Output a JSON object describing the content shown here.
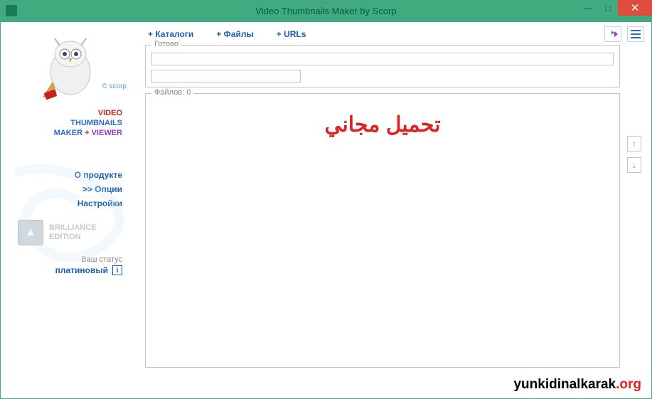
{
  "window": {
    "title": "Video Thumbnails Maker by Scorp"
  },
  "sidebar": {
    "copyright": "© scorp",
    "title_line1": "VIDEO",
    "title_line2": "THUMBNAILS",
    "title_line3a": "MAKER",
    "title_plus": " + ",
    "title_line3b": "VIEWER",
    "menu": {
      "about": "О продукте",
      "options": ">> Опции",
      "settings": "Настройки"
    },
    "edition_line1": "BRILLIANCE",
    "edition_line2": "EDITION",
    "status_label": "Ваш статус",
    "status_value": "платиновый",
    "info_char": "i"
  },
  "toolbar": {
    "catalogs": "+ Каталоги",
    "files": "+ Файлы",
    "urls": "+ URLs"
  },
  "ready_fieldset": {
    "legend": "Готово"
  },
  "files_fieldset": {
    "legend": "Файлов: 0",
    "overlay_text": "تحميل مجاني"
  },
  "arrows": {
    "up": "↑",
    "down": "↓"
  },
  "watermark": {
    "domain": "yunkidinalkarak",
    "tld": ".org"
  }
}
